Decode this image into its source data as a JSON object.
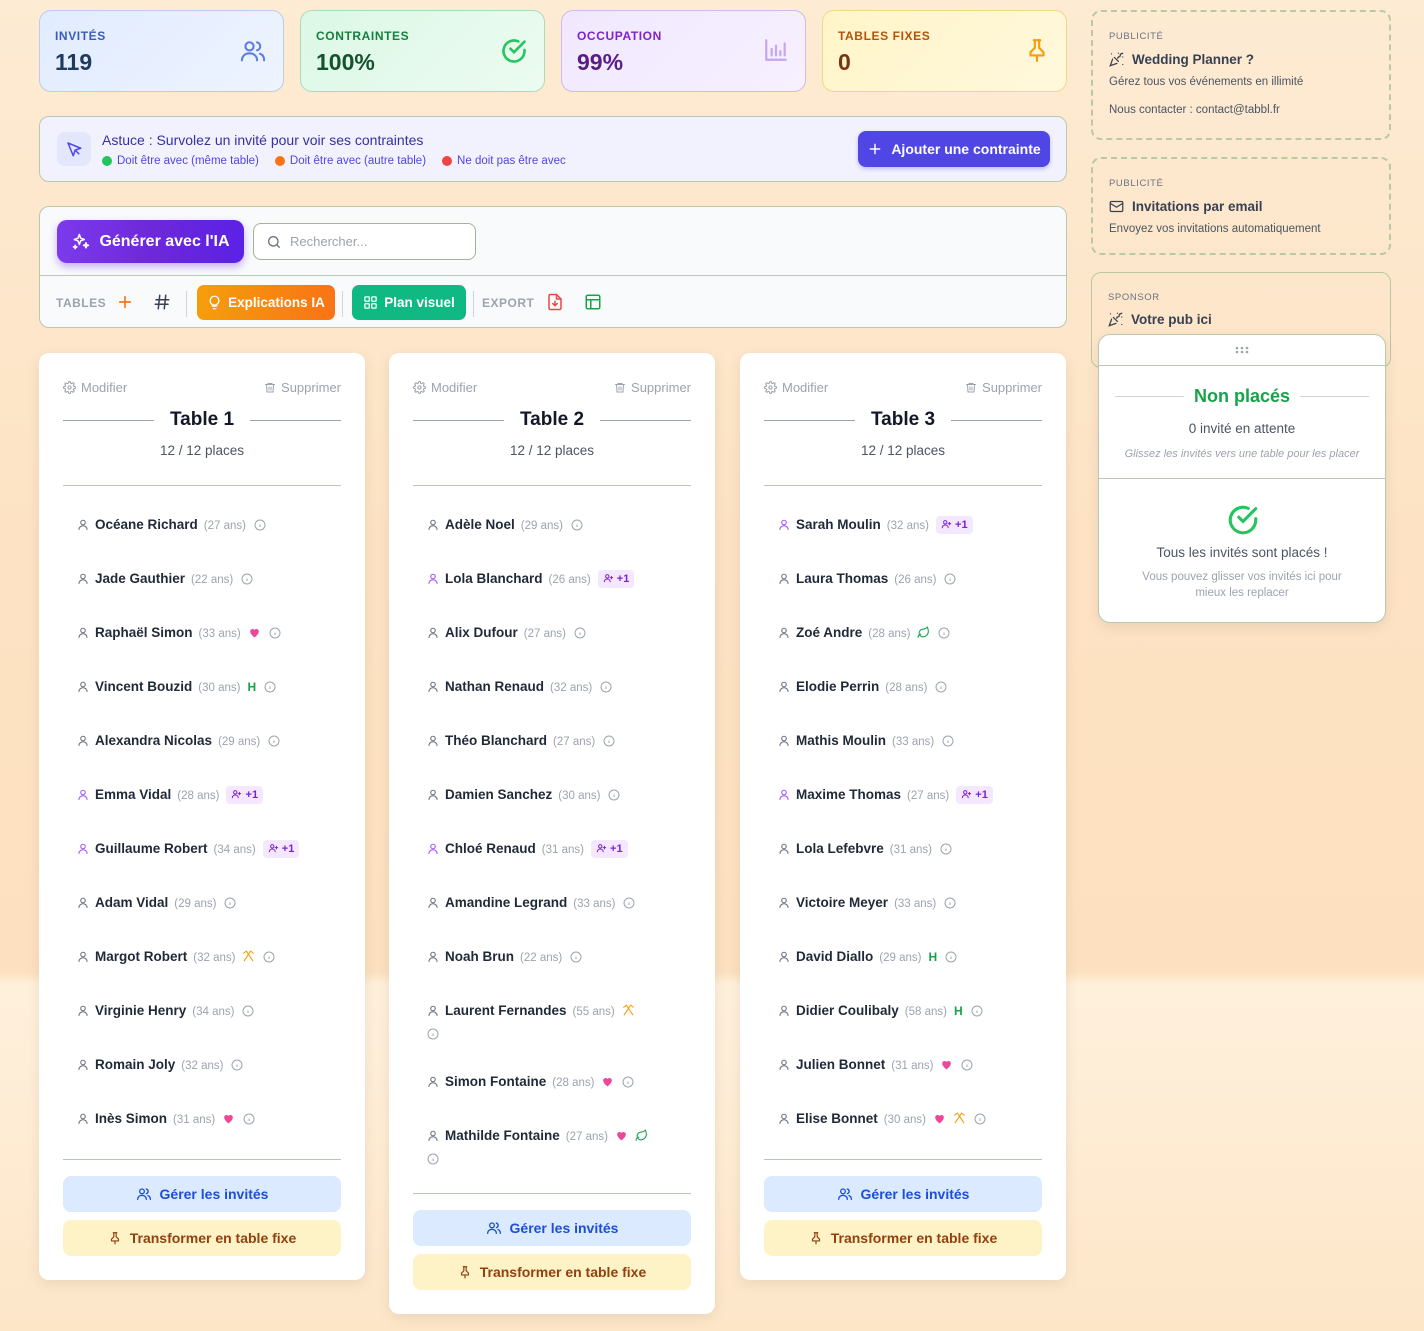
{
  "stats": [
    {
      "label": "INVITÉS",
      "value": "119",
      "icon": "users-icon",
      "color": "#3b5bbb"
    },
    {
      "label": "CONTRAINTES",
      "value": "100%",
      "icon": "check-circle-icon",
      "color": "#15803d"
    },
    {
      "label": "OCCUPATION",
      "value": "99%",
      "icon": "bar-chart-icon",
      "color": "#7e22ce"
    },
    {
      "label": "TABLES FIXES",
      "value": "0",
      "icon": "pin-icon",
      "color": "#b45309"
    }
  ],
  "tip": {
    "title": "Astuce : Survolez un invité pour voir ses contraintes",
    "legend": [
      {
        "label": "Doit être avec (même table)",
        "color": "#22c55e"
      },
      {
        "label": "Doit être avec (autre table)",
        "color": "#f97316"
      },
      {
        "label": "Ne doit pas être avec",
        "color": "#ef4444"
      }
    ],
    "add_button": "Ajouter une contrainte"
  },
  "toolbar": {
    "ai_button": "Générer avec l'IA",
    "search_placeholder": "Rechercher...",
    "tables_label": "TABLES",
    "explications_button": "Explications IA",
    "plan_button": "Plan visuel",
    "export_label": "EXPORT"
  },
  "ads": [
    {
      "tag": "PUBLICITÉ",
      "title": "Wedding Planner ?",
      "line1": "Gérez tous vos événements en illimité",
      "line2": "Nous contacter : contact@tabbl.fr"
    },
    {
      "tag": "PUBLICITÉ",
      "title": "Invitations par email",
      "line1": "Envoyez vos invitations automatiquement"
    },
    {
      "tag": "SPONSOR",
      "title": "Votre pub ici"
    }
  ],
  "table_common": {
    "modify": "Modifier",
    "delete": "Supprimer",
    "manage_button": "Gérer les invités",
    "fix_button": "Transformer en table fixe"
  },
  "tables": [
    {
      "name": "Table 1",
      "places": "12 / 12 places",
      "guests": [
        {
          "name": "Océane Richard",
          "age": "(27 ans)"
        },
        {
          "name": "Jade Gauthier",
          "age": "(22 ans)"
        },
        {
          "name": "Raphaël Simon",
          "age": "(33 ans)",
          "heart": true
        },
        {
          "name": "Vincent Bouzid",
          "age": "(30 ans)",
          "tag": "H"
        },
        {
          "name": "Alexandra Nicolas",
          "age": "(29 ans)"
        },
        {
          "name": "Emma Vidal",
          "age": "(28 ans)",
          "plus": "+1"
        },
        {
          "name": "Guillaume Robert",
          "age": "(34 ans)",
          "plus": "+1"
        },
        {
          "name": "Adam Vidal",
          "age": "(29 ans)"
        },
        {
          "name": "Margot Robert",
          "age": "(32 ans)",
          "fork": true
        },
        {
          "name": "Virginie Henry",
          "age": "(34 ans)"
        },
        {
          "name": "Romain Joly",
          "age": "(32 ans)"
        },
        {
          "name": "Inès Simon",
          "age": "(31 ans)",
          "heart": true
        }
      ]
    },
    {
      "name": "Table 2",
      "places": "12 / 12 places",
      "guests": [
        {
          "name": "Adèle Noel",
          "age": "(29 ans)"
        },
        {
          "name": "Lola Blanchard",
          "age": "(26 ans)",
          "plus": "+1"
        },
        {
          "name": "Alix Dufour",
          "age": "(27 ans)"
        },
        {
          "name": "Nathan Renaud",
          "age": "(32 ans)"
        },
        {
          "name": "Théo Blanchard",
          "age": "(27 ans)"
        },
        {
          "name": "Damien Sanchez",
          "age": "(30 ans)"
        },
        {
          "name": "Chloé Renaud",
          "age": "(31 ans)",
          "plus": "+1"
        },
        {
          "name": "Amandine Legrand",
          "age": "(33 ans)"
        },
        {
          "name": "Noah Brun",
          "age": "(22 ans)"
        },
        {
          "name": "Laurent Fernandes",
          "age": "(55 ans)",
          "fork": true
        },
        {
          "name": "Simon Fontaine",
          "age": "(28 ans)",
          "heart": true
        },
        {
          "name": "Mathilde Fontaine",
          "age": "(27 ans)",
          "heart": true,
          "leaf": true
        }
      ]
    },
    {
      "name": "Table 3",
      "places": "12 / 12 places",
      "guests": [
        {
          "name": "Sarah Moulin",
          "age": "(32 ans)",
          "plus": "+1"
        },
        {
          "name": "Laura Thomas",
          "age": "(26 ans)"
        },
        {
          "name": "Zoé Andre",
          "age": "(28 ans)",
          "leaf": true
        },
        {
          "name": "Elodie Perrin",
          "age": "(28 ans)"
        },
        {
          "name": "Mathis Moulin",
          "age": "(33 ans)"
        },
        {
          "name": "Maxime Thomas",
          "age": "(27 ans)",
          "plus": "+1"
        },
        {
          "name": "Lola Lefebvre",
          "age": "(31 ans)"
        },
        {
          "name": "Victoire Meyer",
          "age": "(33 ans)"
        },
        {
          "name": "David Diallo",
          "age": "(29 ans)",
          "tag": "H"
        },
        {
          "name": "Didier Coulibaly",
          "age": "(58 ans)",
          "tag": "H"
        },
        {
          "name": "Julien Bonnet",
          "age": "(31 ans)",
          "heart": true
        },
        {
          "name": "Elise Bonnet",
          "age": "(30 ans)",
          "heart": true,
          "fork": true
        }
      ]
    }
  ],
  "unplaced": {
    "title": "Non placés",
    "count": "0 invité en attente",
    "hint": "Glissez les invités vers une table pour les placer",
    "done": "Tous les invités sont placés !",
    "sub": "Vous pouvez glisser vos invités ici pour mieux les replacer"
  }
}
